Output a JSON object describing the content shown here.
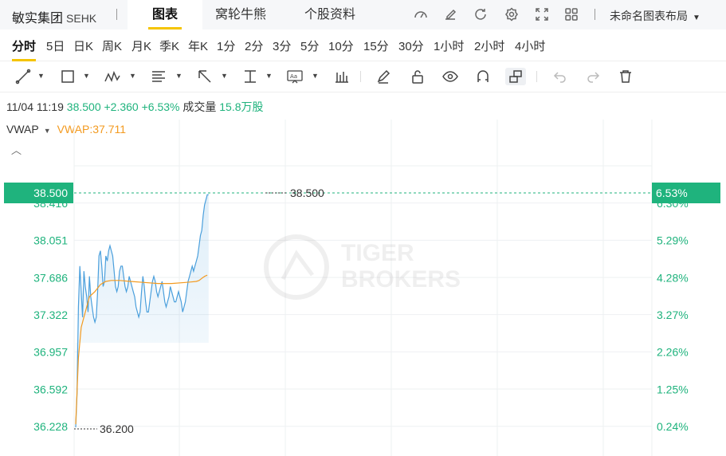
{
  "header": {
    "stock_name": "敏实集团",
    "stock_code": "SEHK",
    "tabs": [
      {
        "label": "图表",
        "active": true
      },
      {
        "label": "窝轮牛熊",
        "active": false
      },
      {
        "label": "个股资料",
        "active": false
      }
    ],
    "icons": [
      "speed-icon",
      "edit-icon",
      "refresh-icon",
      "settings-icon",
      "fullscreen-icon",
      "grid-icon"
    ],
    "layout_label": "未命名图表布局"
  },
  "periods": {
    "items": [
      "分时",
      "5日",
      "日K",
      "周K",
      "月K",
      "季K",
      "年K",
      "1分",
      "2分",
      "3分",
      "5分",
      "10分",
      "15分",
      "30分",
      "1小时",
      "2小时",
      "4小时"
    ],
    "active_index": 0
  },
  "toolbar": {
    "tools": [
      "line-tool-icon",
      "rect-tool-icon",
      "wave-tool-icon",
      "fib-tool-icon",
      "arrow-tool-icon",
      "measure-tool-icon",
      "text-tool-icon",
      "indicator-icon",
      "pen-icon",
      "lock-icon",
      "eye-icon",
      "magnet-icon",
      "link-icon",
      "undo-icon",
      "redo-icon",
      "trash-icon"
    ]
  },
  "quote": {
    "datetime": "11/04 11:19",
    "price": "38.500",
    "change": "+2.360",
    "change_pct": "+6.53%",
    "volume_label": "成交量",
    "volume": "15.8万股"
  },
  "indicator": {
    "name": "VWAP",
    "value_text": "VWAP:37.711"
  },
  "colors": {
    "up": "#1fb37d",
    "price_line": "#4a9fdc",
    "vwap_line": "#f39a1f",
    "grid": "#eef0f2"
  },
  "chart_data": {
    "type": "line",
    "y_left_ticks": [
      "38.416",
      "38.051",
      "37.686",
      "37.322",
      "36.957",
      "36.592",
      "36.228"
    ],
    "y_right_ticks": [
      "6.30%",
      "5.29%",
      "4.28%",
      "3.27%",
      "2.26%",
      "1.25%",
      "0.24%"
    ],
    "ylim": [
      36.14,
      38.6
    ],
    "last_price_label": "38.500",
    "last_pct_label": "6.53%",
    "high_label": "38.500",
    "low_label": "36.200",
    "series": [
      {
        "name": "price",
        "x": [
          0,
          1,
          2,
          3,
          4,
          5,
          6,
          7,
          8,
          9,
          10,
          11,
          12,
          13,
          14,
          15,
          16,
          17,
          18,
          19,
          20,
          21,
          22,
          23,
          24,
          25,
          26,
          27,
          28,
          29,
          30,
          31,
          32,
          33,
          34,
          35,
          36,
          37,
          38,
          39,
          40,
          41,
          42,
          43,
          44,
          45,
          46,
          47,
          48,
          49,
          50,
          51,
          52,
          53,
          54,
          55,
          56,
          57,
          58,
          59,
          60,
          61,
          62,
          63,
          64,
          65,
          66,
          67,
          68,
          69,
          70,
          71,
          72,
          73,
          74,
          75,
          76,
          77,
          78,
          79,
          80,
          81,
          82,
          83,
          84,
          85,
          86,
          87,
          88,
          89,
          90,
          91,
          92,
          93,
          94,
          95,
          96,
          97,
          98,
          99,
          100,
          101,
          102,
          103,
          104,
          105,
          106,
          107,
          108,
          109,
          110,
          111,
          112,
          113,
          114,
          115,
          116,
          117,
          118,
          119,
          120,
          121,
          122,
          123,
          124,
          125,
          126,
          127,
          128,
          129,
          130,
          131,
          132,
          133,
          134,
          135,
          136,
          137,
          138,
          139
        ],
        "values": [
          36.22,
          36.55,
          37.4,
          37.8,
          37.55,
          37.3,
          37.75,
          37.6,
          37.5,
          37.35,
          37.7,
          37.5,
          37.4,
          37.3,
          37.25,
          37.3,
          37.55,
          37.9,
          37.95,
          37.8,
          37.6,
          37.65,
          37.9,
          37.85,
          37.95,
          38.0,
          37.95,
          37.9,
          37.75,
          37.6,
          37.55,
          37.6,
          37.75,
          37.8,
          37.8,
          37.7,
          37.6,
          37.55,
          37.6,
          37.7,
          37.65,
          37.6,
          37.55,
          37.5,
          37.4,
          37.35,
          37.3,
          37.35,
          37.55,
          37.7,
          37.6,
          37.45,
          37.35,
          37.35,
          37.45,
          37.55,
          37.65,
          37.7,
          37.65,
          37.55,
          37.5,
          37.55,
          37.6,
          37.65,
          37.55,
          37.45,
          37.4,
          37.45,
          37.5,
          37.6,
          37.55,
          37.5,
          37.45,
          37.45,
          37.5,
          37.55,
          37.5,
          37.45,
          37.35,
          37.4,
          37.45,
          37.55,
          37.65,
          37.7,
          37.75,
          37.8,
          37.75,
          37.8,
          37.85,
          37.9,
          38.0,
          38.1,
          38.15,
          38.3,
          38.4,
          38.45,
          38.5,
          38.5,
          38.5,
          38.5,
          38.5,
          38.5,
          38.5,
          38.5,
          38.5,
          38.5,
          38.5,
          38.5,
          38.5,
          38.5,
          38.5,
          38.5,
          38.5,
          38.5,
          38.5,
          38.5,
          38.5,
          38.5,
          38.5,
          38.5,
          38.5,
          38.5,
          38.5,
          38.5,
          38.5,
          38.5,
          38.5,
          38.5,
          38.5,
          38.5,
          38.5,
          38.5,
          38.5,
          38.5,
          38.5,
          38.5,
          38.5,
          38.5,
          38.5,
          38.5
        ]
      },
      {
        "name": "VWAP",
        "x": [
          0,
          2,
          4,
          6,
          8,
          10,
          14,
          18,
          22,
          26,
          32,
          40,
          50,
          60,
          70,
          80,
          84,
          88,
          90,
          92,
          94,
          96
        ],
        "values": [
          36.25,
          36.9,
          37.2,
          37.3,
          37.4,
          37.5,
          37.55,
          37.62,
          37.65,
          37.66,
          37.66,
          37.65,
          37.64,
          37.63,
          37.63,
          37.64,
          37.645,
          37.65,
          37.66,
          37.68,
          37.7,
          37.711
        ]
      }
    ],
    "x_count": 140
  }
}
